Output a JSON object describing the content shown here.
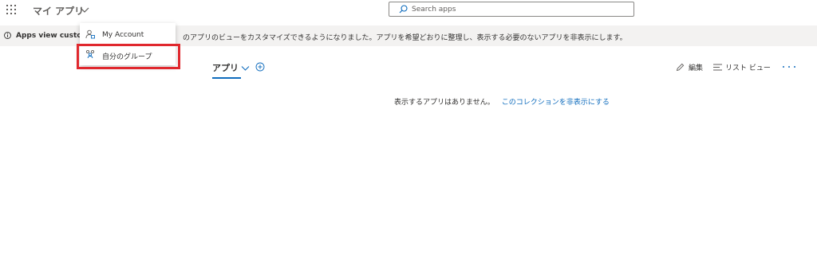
{
  "header": {
    "app_title": "マイ アプリ",
    "search_placeholder": "Search apps"
  },
  "banner": {
    "bold_text": "Apps view custom",
    "text": "のアプリのビューをカスタマイズできるようになりました。アプリを希望どおりに整理し、表示する必要のないアプリを非表示にします。"
  },
  "dropdown": {
    "items": [
      {
        "label": "My Account",
        "icon": "person-account-icon"
      },
      {
        "label": "自分のグループ",
        "icon": "people-group-icon"
      }
    ]
  },
  "apps_header": {
    "tab_label": "アプリ",
    "edit_label": "編集",
    "list_view_label": "リスト ビュー"
  },
  "empty_state": {
    "message": "表示するアプリはありません。",
    "link": "このコレクションを非表示にする"
  },
  "colors": {
    "accent": "#0f6cbd",
    "highlight_box": "#e0282e",
    "banner_bg": "#f3f2f1"
  }
}
